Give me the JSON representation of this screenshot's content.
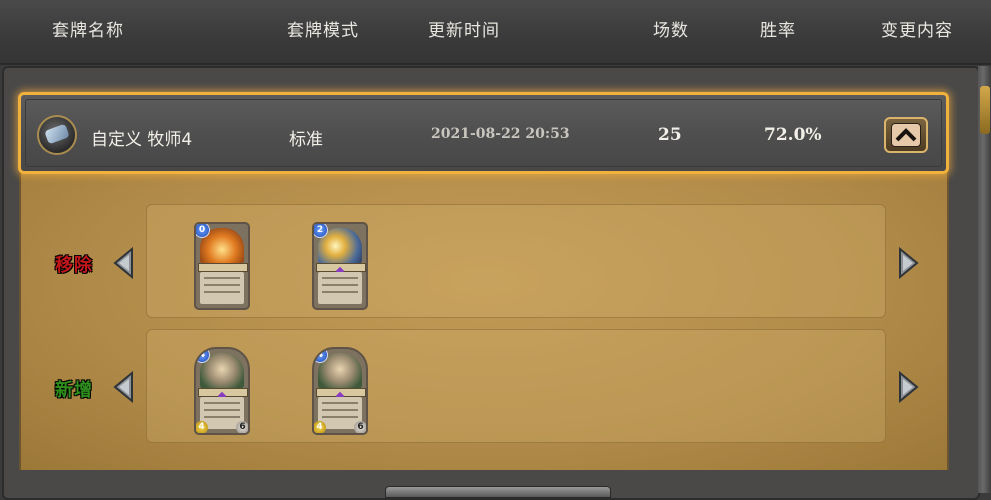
{
  "header": {
    "col_name": "套牌名称",
    "col_mode": "套牌模式",
    "col_updated": "更新时间",
    "col_games": "场数",
    "col_winrate": "胜率",
    "col_changes": "变更内容"
  },
  "deck": {
    "name": "自定义 牧师4",
    "mode": "标准",
    "updated": "2021-08-22  20:53",
    "games": "25",
    "winrate": "72.0%",
    "class_icon": "priest-class-icon",
    "expanded": true
  },
  "changes": {
    "removed_label": "移除",
    "added_label": "新增",
    "removed_color": "#c0171b",
    "added_color": "#2e8f1c",
    "removed_cards": [
      {
        "cost": "0",
        "art": "flame-tree",
        "type": "spell"
      },
      {
        "cost": "2",
        "art": "sky-light",
        "type": "spell"
      }
    ],
    "added_cards": [
      {
        "cost": "4",
        "attack": "4",
        "health": "6",
        "type": "minion"
      },
      {
        "cost": "4",
        "attack": "4",
        "health": "6",
        "type": "minion"
      }
    ]
  },
  "colors": {
    "highlight_border": "#f0b23c",
    "parchment": "#b48f4d",
    "header_bg": "#404040"
  }
}
